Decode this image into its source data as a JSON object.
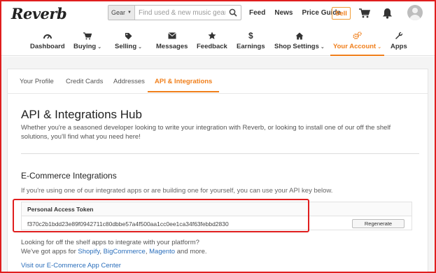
{
  "header": {
    "logo": "Reverb",
    "search": {
      "category": "Gear",
      "placeholder": "Find used & new music gear..."
    },
    "links": [
      "Feed",
      "News",
      "Price Guide"
    ],
    "sell_label": "Sell",
    "icons": [
      "cart-icon",
      "bell-icon",
      "avatar"
    ]
  },
  "nav": {
    "items": [
      {
        "label": "Dashboard",
        "icon": "dashboard-icon",
        "dropdown": false
      },
      {
        "label": "Buying",
        "icon": "cart-icon",
        "dropdown": true
      },
      {
        "label": "Selling",
        "icon": "tag-icon",
        "dropdown": true
      },
      {
        "label": "Messages",
        "icon": "envelope-icon",
        "dropdown": false
      },
      {
        "label": "Feedback",
        "icon": "star-icon",
        "dropdown": false
      },
      {
        "label": "Earnings",
        "icon": "dollar-icon",
        "dropdown": false
      },
      {
        "label": "Shop Settings",
        "icon": "home-icon",
        "dropdown": true
      },
      {
        "label": "Your Account",
        "icon": "gears-icon",
        "dropdown": true,
        "active": true
      },
      {
        "label": "Apps",
        "icon": "wrench-icon",
        "dropdown": false
      }
    ]
  },
  "tabs": [
    {
      "label": "Your Profile"
    },
    {
      "label": "Credit Cards"
    },
    {
      "label": "Addresses"
    },
    {
      "label": "API & Integrations",
      "active": true
    }
  ],
  "main": {
    "title": "API & Integrations Hub",
    "intro": "Whether you're a seasoned developer looking to write your integration with Reverb, or looking to install one of our off the shelf solutions, you'll find what you need here!",
    "ecommerce": {
      "heading": "E-Commerce Integrations",
      "subtitle": "If you're using one of our integrated apps or are building one for yourself, you can use your API key below.",
      "token_header": "Personal Access Token",
      "token": "f370c2b1bdd23e89f0942711c80dbbe57a4f500aa1cc0ee1ca34f63febbd2830",
      "regenerate_label": "Regenerate"
    },
    "shelf": {
      "line1": "Looking for off the shelf apps to integrate with your platform?",
      "line2_prefix": "We've got apps for ",
      "apps": [
        "Shopify",
        "BigCommerce",
        "Magento"
      ],
      "sep1": ", ",
      "sep2": ", ",
      "suffix": " and more."
    },
    "visit_link": "Visit our E-Commerce App Center"
  },
  "colors": {
    "accent": "#f07f1b",
    "link": "#2a6ebb",
    "highlight": "#e01e1e"
  }
}
